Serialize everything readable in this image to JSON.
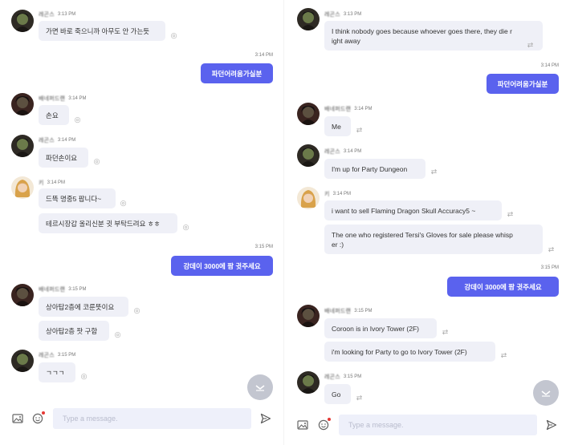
{
  "left": {
    "messages": {
      "m1": {
        "sender": "레곤스",
        "time": "3:13 PM",
        "text": "가면 바로 죽으니까 아무도 안 가는듯"
      },
      "o1": {
        "time": "3:14 PM",
        "text": "파던어려움가실분"
      },
      "m2": {
        "sender": "배네퍼드랜",
        "time": "3:14 PM",
        "text": "손요"
      },
      "m3": {
        "sender": "레곤스",
        "time": "3:14 PM",
        "text": "파던손이요"
      },
      "m4": {
        "sender": "키",
        "time": "3:14 PM",
        "text1": "드뜩 명중5 팝니다~",
        "text2": "테르시장갑 올리신분 귓 부탁드려요 ㅎㅎ"
      },
      "o2": {
        "time": "3:15 PM",
        "text": "강데이 3000에 팜 귓주세요"
      },
      "m5": {
        "sender": "배네퍼드랜",
        "time": "3:15 PM",
        "text1": "상아탑2층에 코룬뜻이요",
        "text2": "상아탑2층 팟 구함"
      },
      "m6": {
        "sender": "레곤스",
        "time": "3:15 PM",
        "text": "ㄱㄱㄱ"
      }
    },
    "composer": {
      "placeholder": "Type a message."
    }
  },
  "right": {
    "messages": {
      "m1": {
        "sender": "레곤스",
        "time": "3:13 PM",
        "line1": "I think nobody goes because whoever goes there, they die r",
        "line2": "ight away"
      },
      "o1": {
        "time": "3:14 PM",
        "text": "파던어려움가실분"
      },
      "m2": {
        "sender": "배네퍼드랜",
        "time": "3:14 PM",
        "text": "Me"
      },
      "m3": {
        "sender": "레곤스",
        "time": "3:14 PM",
        "text": "I'm up for Party Dungeon"
      },
      "m4": {
        "sender": "키",
        "time": "3:14 PM",
        "text1": "i want to sell Flaming Dragon Skull Accuracy5 ~",
        "line2a": "The one who registered Tersi's Gloves for sale please whisp",
        "line2b": "er :)"
      },
      "o2": {
        "time": "3:15 PM",
        "text": "강데이 3000에 팜 귓주세요"
      },
      "m5": {
        "sender": "배네퍼드랜",
        "time": "3:15 PM",
        "text1": "Coroon is in Ivory Tower (2F)",
        "text2": "i'm looking for Party to go to Ivory Tower (2F)"
      },
      "m6": {
        "sender": "레곤스",
        "time": "3:15 PM",
        "text": "Go"
      }
    },
    "composer": {
      "placeholder": "Type a message."
    }
  },
  "icons": [
    "globe-icon",
    "translate-icon",
    "image-icon",
    "emoji-icon",
    "send-icon",
    "chevron-down-icon",
    "avatar-dark",
    "avatar-blonde"
  ],
  "colors": {
    "accent": "#5a62ee",
    "bubble": "#eff0f7",
    "input": "#eef0fa",
    "fab": "#c3c6d0",
    "dot": "#e53935"
  }
}
